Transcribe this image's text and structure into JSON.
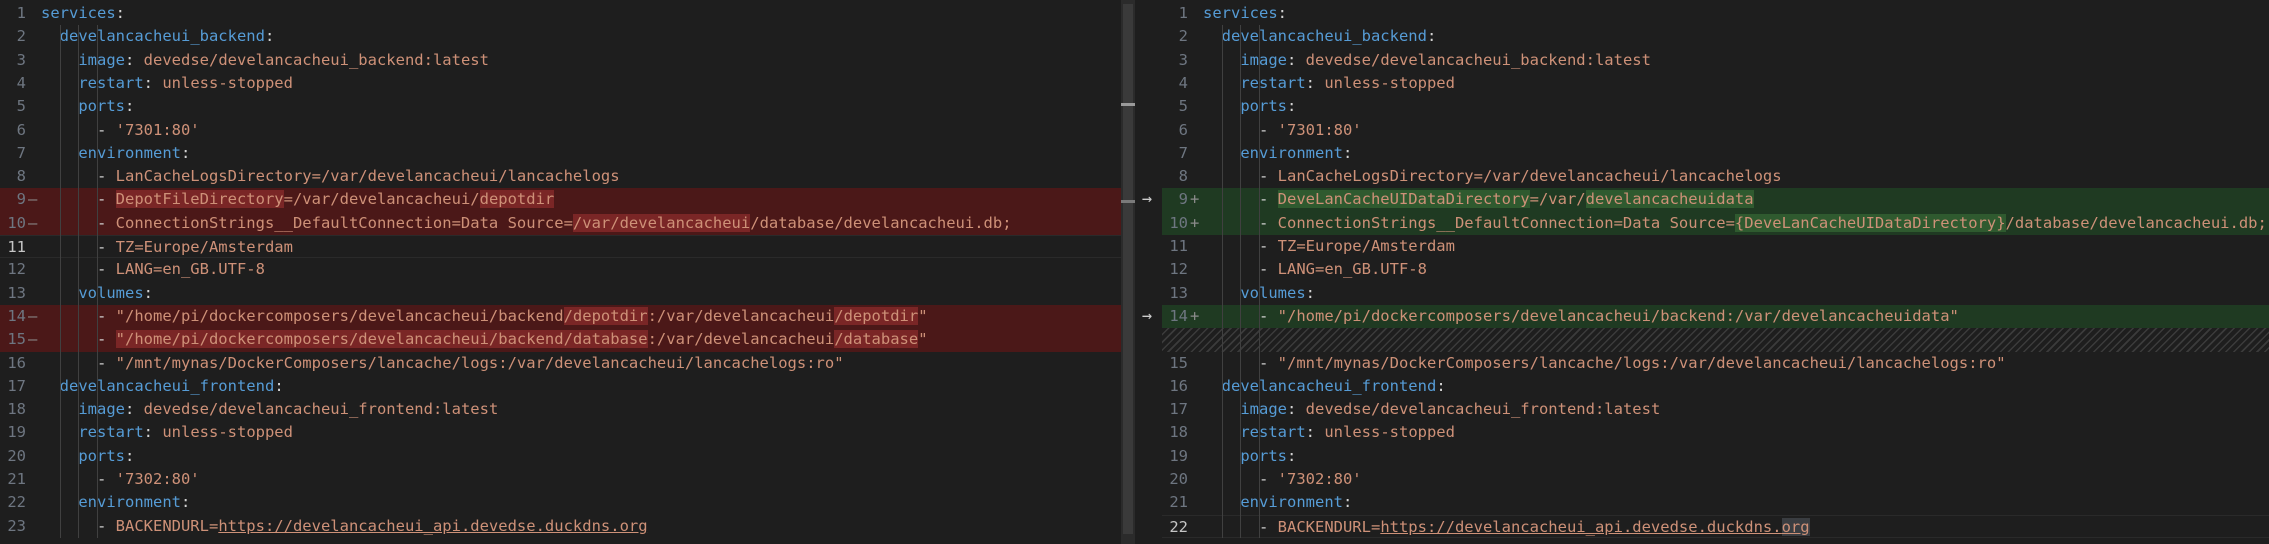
{
  "left": {
    "lines": [
      {
        "n": "1",
        "mk": "",
        "cls": "",
        "segs": [
          [
            "k",
            "services"
          ],
          [
            "p",
            ":"
          ]
        ]
      },
      {
        "n": "2",
        "mk": "",
        "cls": "",
        "segs": [
          [
            "p",
            "  "
          ],
          [
            "k",
            "develancacheui_backend"
          ],
          [
            "p",
            ":"
          ]
        ]
      },
      {
        "n": "3",
        "mk": "",
        "cls": "",
        "segs": [
          [
            "p",
            "    "
          ],
          [
            "k",
            "image"
          ],
          [
            "p",
            ": "
          ],
          [
            "s",
            "devedse/develancacheui_backend:latest"
          ]
        ]
      },
      {
        "n": "4",
        "mk": "",
        "cls": "",
        "segs": [
          [
            "p",
            "    "
          ],
          [
            "k",
            "restart"
          ],
          [
            "p",
            ": "
          ],
          [
            "s",
            "unless-stopped"
          ]
        ]
      },
      {
        "n": "5",
        "mk": "",
        "cls": "",
        "segs": [
          [
            "p",
            "    "
          ],
          [
            "k",
            "ports"
          ],
          [
            "p",
            ":"
          ]
        ]
      },
      {
        "n": "6",
        "mk": "",
        "cls": "",
        "segs": [
          [
            "p",
            "      - "
          ],
          [
            "s",
            "'7301:80'"
          ]
        ]
      },
      {
        "n": "7",
        "mk": "",
        "cls": "",
        "segs": [
          [
            "p",
            "    "
          ],
          [
            "k",
            "environment"
          ],
          [
            "p",
            ":"
          ]
        ]
      },
      {
        "n": "8",
        "mk": "",
        "cls": "",
        "segs": [
          [
            "p",
            "      - "
          ],
          [
            "s",
            "LanCacheLogsDirectory=/var/develancacheui/lancachelogs"
          ]
        ]
      },
      {
        "n": "9",
        "mk": "—",
        "cls": "del",
        "segs": [
          [
            "p",
            "      - "
          ],
          [
            "s wdel",
            "DepotFileDirectory"
          ],
          [
            "s",
            "=/var/develancacheui/"
          ],
          [
            "s wdel",
            "depotdir"
          ]
        ]
      },
      {
        "n": "10",
        "mk": "—",
        "cls": "del",
        "segs": [
          [
            "p",
            "      - "
          ],
          [
            "s",
            "ConnectionStrings__DefaultConnection=Data Source="
          ],
          [
            "s wdel",
            "/var/develancacheui"
          ],
          [
            "s",
            "/database/develancacheui.db;"
          ]
        ]
      },
      {
        "n": "11",
        "mk": "",
        "cls": "cur",
        "segs": [
          [
            "p",
            "      - "
          ],
          [
            "s",
            "TZ=Europe/Amsterdam"
          ]
        ]
      },
      {
        "n": "12",
        "mk": "",
        "cls": "",
        "segs": [
          [
            "p",
            "      - "
          ],
          [
            "s",
            "LANG=en_GB.UTF-8"
          ]
        ]
      },
      {
        "n": "13",
        "mk": "",
        "cls": "",
        "segs": [
          [
            "p",
            "    "
          ],
          [
            "k",
            "volumes"
          ],
          [
            "p",
            ":"
          ]
        ]
      },
      {
        "n": "14",
        "mk": "—",
        "cls": "del",
        "segs": [
          [
            "p",
            "      - "
          ],
          [
            "s",
            "\"/home/pi/dockercomposers/develancacheui/backend"
          ],
          [
            "s wdel",
            "/depotdir"
          ],
          [
            "s",
            ":/var/develancacheui"
          ],
          [
            "s wdel",
            "/depotdir"
          ],
          [
            "s",
            "\""
          ]
        ]
      },
      {
        "n": "15",
        "mk": "—",
        "cls": "del",
        "segs": [
          [
            "p",
            "      - "
          ],
          [
            "s wdel",
            "\"/home/pi/dockercomposers/develancacheui/backend/database"
          ],
          [
            "s",
            ":/var/develancacheui"
          ],
          [
            "s wdel",
            "/database"
          ],
          [
            "s",
            "\""
          ]
        ]
      },
      {
        "n": "16",
        "mk": "",
        "cls": "",
        "segs": [
          [
            "p",
            "      - "
          ],
          [
            "s",
            "\"/mnt/mynas/DockerComposers/lancache/logs:/var/develancacheui/lancachelogs:ro\""
          ]
        ]
      },
      {
        "n": "17",
        "mk": "",
        "cls": "",
        "segs": [
          [
            "p",
            "  "
          ],
          [
            "k",
            "develancacheui_frontend"
          ],
          [
            "p",
            ":"
          ]
        ]
      },
      {
        "n": "18",
        "mk": "",
        "cls": "",
        "segs": [
          [
            "p",
            "    "
          ],
          [
            "k",
            "image"
          ],
          [
            "p",
            ": "
          ],
          [
            "s",
            "devedse/develancacheui_frontend:latest"
          ]
        ]
      },
      {
        "n": "19",
        "mk": "",
        "cls": "",
        "segs": [
          [
            "p",
            "    "
          ],
          [
            "k",
            "restart"
          ],
          [
            "p",
            ": "
          ],
          [
            "s",
            "unless-stopped"
          ]
        ]
      },
      {
        "n": "20",
        "mk": "",
        "cls": "",
        "segs": [
          [
            "p",
            "    "
          ],
          [
            "k",
            "ports"
          ],
          [
            "p",
            ":"
          ]
        ]
      },
      {
        "n": "21",
        "mk": "",
        "cls": "",
        "segs": [
          [
            "p",
            "      - "
          ],
          [
            "s",
            "'7302:80'"
          ]
        ]
      },
      {
        "n": "22",
        "mk": "",
        "cls": "",
        "segs": [
          [
            "p",
            "    "
          ],
          [
            "k",
            "environment"
          ],
          [
            "p",
            ":"
          ]
        ]
      },
      {
        "n": "23",
        "mk": "",
        "cls": "",
        "segs": [
          [
            "p",
            "      - "
          ],
          [
            "s",
            "BACKENDURL="
          ],
          [
            "s u",
            "https://develancacheui_api.devedse.duckdns.org"
          ]
        ]
      }
    ]
  },
  "right": {
    "lines": [
      {
        "n": "1",
        "mk": "",
        "cls": "",
        "segs": [
          [
            "k",
            "services"
          ],
          [
            "p",
            ":"
          ]
        ]
      },
      {
        "n": "2",
        "mk": "",
        "cls": "",
        "segs": [
          [
            "p",
            "  "
          ],
          [
            "k",
            "develancacheui_backend"
          ],
          [
            "p",
            ":"
          ]
        ]
      },
      {
        "n": "3",
        "mk": "",
        "cls": "",
        "segs": [
          [
            "p",
            "    "
          ],
          [
            "k",
            "image"
          ],
          [
            "p",
            ": "
          ],
          [
            "s",
            "devedse/develancacheui_backend:latest"
          ]
        ]
      },
      {
        "n": "4",
        "mk": "",
        "cls": "",
        "segs": [
          [
            "p",
            "    "
          ],
          [
            "k",
            "restart"
          ],
          [
            "p",
            ": "
          ],
          [
            "s",
            "unless-stopped"
          ]
        ]
      },
      {
        "n": "5",
        "mk": "",
        "cls": "",
        "segs": [
          [
            "p",
            "    "
          ],
          [
            "k",
            "ports"
          ],
          [
            "p",
            ":"
          ]
        ]
      },
      {
        "n": "6",
        "mk": "",
        "cls": "",
        "segs": [
          [
            "p",
            "      - "
          ],
          [
            "s",
            "'7301:80'"
          ]
        ]
      },
      {
        "n": "7",
        "mk": "",
        "cls": "",
        "segs": [
          [
            "p",
            "    "
          ],
          [
            "k",
            "environment"
          ],
          [
            "p",
            ":"
          ]
        ]
      },
      {
        "n": "8",
        "mk": "",
        "cls": "",
        "segs": [
          [
            "p",
            "      - "
          ],
          [
            "s",
            "LanCacheLogsDirectory=/var/develancacheui/lancachelogs"
          ]
        ]
      },
      {
        "n": "9",
        "mk": "+",
        "cls": "ins",
        "segs": [
          [
            "p",
            "      - "
          ],
          [
            "s wins",
            "DeveLanCacheUIDataDirectory"
          ],
          [
            "s",
            "=/var/"
          ],
          [
            "s wins",
            "develancacheuidata"
          ]
        ]
      },
      {
        "n": "10",
        "mk": "+",
        "cls": "ins",
        "segs": [
          [
            "p",
            "      - "
          ],
          [
            "s",
            "ConnectionStrings__DefaultConnection=Data Source="
          ],
          [
            "s wins",
            "{DeveLanCacheUIDataDirectory}"
          ],
          [
            "s",
            "/database/develancacheui.db;"
          ]
        ]
      },
      {
        "n": "11",
        "mk": "",
        "cls": "",
        "segs": [
          [
            "p",
            "      - "
          ],
          [
            "s",
            "TZ=Europe/Amsterdam"
          ]
        ]
      },
      {
        "n": "12",
        "mk": "",
        "cls": "",
        "segs": [
          [
            "p",
            "      - "
          ],
          [
            "s",
            "LANG=en_GB.UTF-8"
          ]
        ]
      },
      {
        "n": "13",
        "mk": "",
        "cls": "",
        "segs": [
          [
            "p",
            "    "
          ],
          [
            "k",
            "volumes"
          ],
          [
            "p",
            ":"
          ]
        ]
      },
      {
        "n": "14",
        "mk": "+",
        "cls": "ins",
        "segs": [
          [
            "p",
            "      - "
          ],
          [
            "s",
            "\"/home/pi/dockercomposers/develancacheui/backend:/var/develancacheuidata\""
          ]
        ]
      },
      {
        "n": "",
        "mk": "",
        "cls": "hatch",
        "segs": []
      },
      {
        "n": "15",
        "mk": "",
        "cls": "",
        "segs": [
          [
            "p",
            "      - "
          ],
          [
            "s",
            "\"/mnt/mynas/DockerComposers/lancache/logs:/var/develancacheui/lancachelogs:ro\""
          ]
        ]
      },
      {
        "n": "16",
        "mk": "",
        "cls": "",
        "segs": [
          [
            "p",
            "  "
          ],
          [
            "k",
            "develancacheui_frontend"
          ],
          [
            "p",
            ":"
          ]
        ]
      },
      {
        "n": "17",
        "mk": "",
        "cls": "",
        "segs": [
          [
            "p",
            "    "
          ],
          [
            "k",
            "image"
          ],
          [
            "p",
            ": "
          ],
          [
            "s",
            "devedse/develancacheui_frontend:latest"
          ]
        ]
      },
      {
        "n": "18",
        "mk": "",
        "cls": "",
        "segs": [
          [
            "p",
            "    "
          ],
          [
            "k",
            "restart"
          ],
          [
            "p",
            ": "
          ],
          [
            "s",
            "unless-stopped"
          ]
        ]
      },
      {
        "n": "19",
        "mk": "",
        "cls": "",
        "segs": [
          [
            "p",
            "    "
          ],
          [
            "k",
            "ports"
          ],
          [
            "p",
            ":"
          ]
        ]
      },
      {
        "n": "20",
        "mk": "",
        "cls": "",
        "segs": [
          [
            "p",
            "      - "
          ],
          [
            "s",
            "'7302:80'"
          ]
        ]
      },
      {
        "n": "21",
        "mk": "",
        "cls": "",
        "segs": [
          [
            "p",
            "    "
          ],
          [
            "k",
            "environment"
          ],
          [
            "p",
            ":"
          ]
        ]
      },
      {
        "n": "22",
        "mk": "",
        "cls": "cur",
        "segs": [
          [
            "p",
            "      - "
          ],
          [
            "s",
            "BACKENDURL="
          ],
          [
            "s u",
            "https://develancacheui_api.devedse.duckdns."
          ],
          [
            "s u sel",
            "org"
          ]
        ]
      }
    ]
  },
  "gutter_arrows": [
    {
      "row": 8,
      "glyph": "→",
      "icon": "revert-change-arrow-icon"
    },
    {
      "row": 13,
      "glyph": "→",
      "icon": "revert-change-arrow-icon"
    }
  ],
  "colors": {
    "background": "#1e1e1e",
    "removed_line": "#4b1818",
    "removed_word": "#7a2626",
    "inserted_line": "#1f3a22",
    "inserted_word": "#2f5a2f",
    "key": "#569cd6",
    "string": "#ce9178"
  }
}
